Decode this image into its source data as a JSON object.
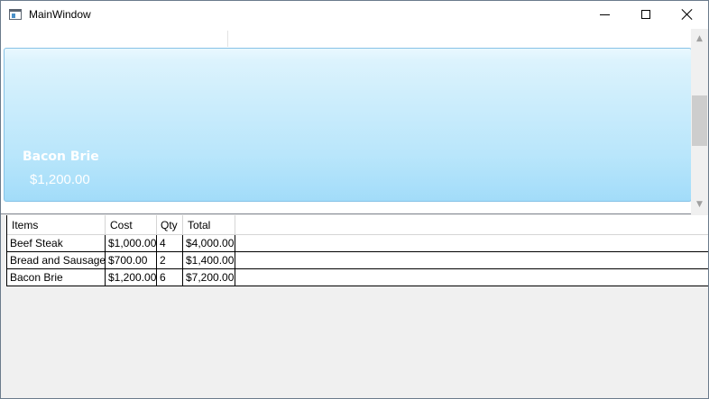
{
  "window": {
    "title": "MainWindow"
  },
  "card": {
    "title": "Bacon Brie",
    "price": "$1,200.00"
  },
  "table": {
    "headers": [
      "Items",
      "Cost",
      "Qty",
      "Total"
    ],
    "rows": [
      [
        "Beef Steak",
        "$1,000.00",
        "4",
        "$4,000.00"
      ],
      [
        "Bread and Sausage",
        "$700.00",
        "2",
        "$1,400.00"
      ],
      [
        "Bacon Brie",
        "$1,200.00",
        "6",
        "$7,200.00"
      ]
    ]
  },
  "icons": {
    "app": "window-app-icon",
    "minimize": "minimize-icon",
    "maximize": "maximize-icon",
    "close": "close-icon",
    "scroll_up": "chevron-up-icon",
    "scroll_down": "chevron-down-icon"
  },
  "colors": {
    "card_top": "#eaf8fe",
    "card_bottom": "#a2dcf9",
    "card_border": "#86c2e6",
    "card_text": "#ffffff"
  }
}
